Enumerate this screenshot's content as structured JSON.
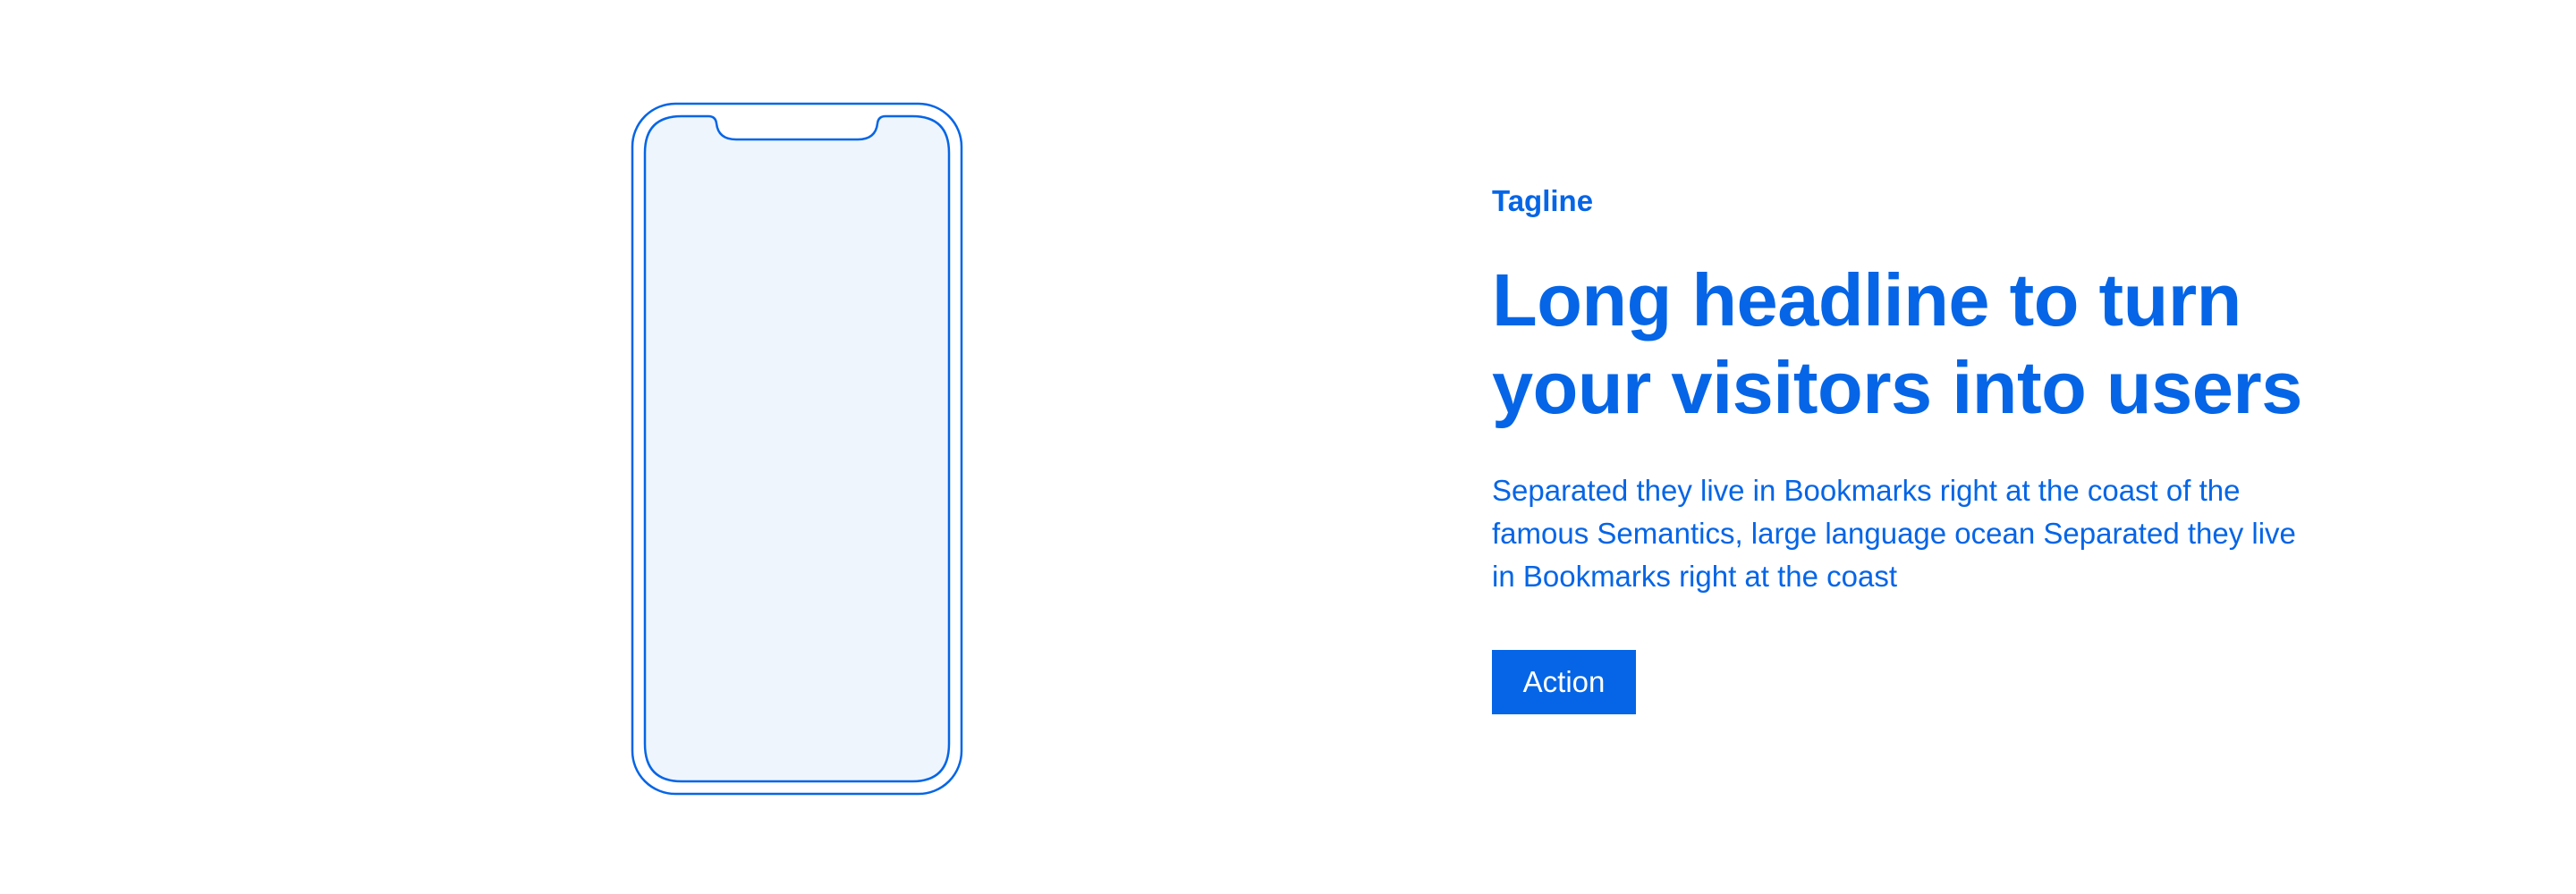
{
  "colors": {
    "accent": "#0565e6",
    "background": "#ffffff",
    "phone_screen": "#eef5fd",
    "button_text": "#ffffff"
  },
  "phone": {
    "icon": "phone-mockup"
  },
  "content": {
    "tagline": "Tagline",
    "headline_line_1": "Long headline to turn",
    "headline_line_2": "your visitors into users",
    "body": "Separated they live in Bookmarks right at the coast of the famous Semantics, large language ocean Separated they live in Bookmarks right at the coast",
    "action_label": "Action"
  }
}
